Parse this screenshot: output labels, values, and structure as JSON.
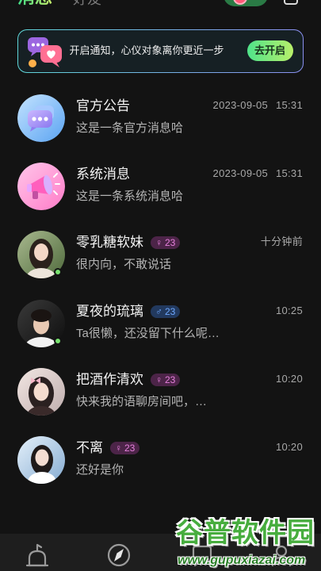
{
  "header": {
    "tabs": [
      {
        "label": "消息",
        "active": true
      },
      {
        "label": "好友",
        "active": false
      }
    ],
    "match_icon": "heart-match-icon",
    "action_icon": "contacts-icon"
  },
  "banner": {
    "icon": "notification-chat-bubbles-icon",
    "text": "开启通知，心仪对象离你更近一步",
    "button_label": "去开启"
  },
  "messages": [
    {
      "avatar_icon": "chat-bubble-icon",
      "name": "官方公告",
      "time": "2023-09-05 15:31",
      "preview": "这是一条官方消息哈"
    },
    {
      "avatar_icon": "megaphone-icon",
      "name": "系统消息",
      "time": "2023-09-05 15:31",
      "preview": "这是一条系统消息哈"
    },
    {
      "name": "零乳糖软妹",
      "gender": "♀",
      "age": "23",
      "time": "十分钟前",
      "preview": "很内向，不敢说话",
      "online": true
    },
    {
      "name": "夏夜的琉璃",
      "gender": "♂",
      "age": "23",
      "time": "10:25",
      "preview": "Ta很懒，还没留下什么呢…",
      "online": true
    },
    {
      "name": "把酒作清欢",
      "gender": "♀",
      "age": "23",
      "time": "10:20",
      "preview": "快来我的语聊房间吧，…",
      "online": false
    },
    {
      "name": "不离",
      "gender": "♀",
      "age": "23",
      "time": "10:20",
      "preview": "还好是你",
      "online": false
    }
  ],
  "bottom_nav": {
    "items": [
      {
        "icon": "party-icon"
      },
      {
        "icon": "compass-icon"
      },
      {
        "icon": "message-icon"
      },
      {
        "icon": "profile-icon"
      }
    ]
  },
  "watermark": {
    "title": "谷普软件园",
    "url": "www.gupuxiazai.com"
  },
  "colors": {
    "background": "#131313",
    "accent_green": "#4fe38a",
    "female_badge": "#e680dc",
    "male_badge": "#6ea8ff",
    "online_dot": "#79e36f"
  }
}
